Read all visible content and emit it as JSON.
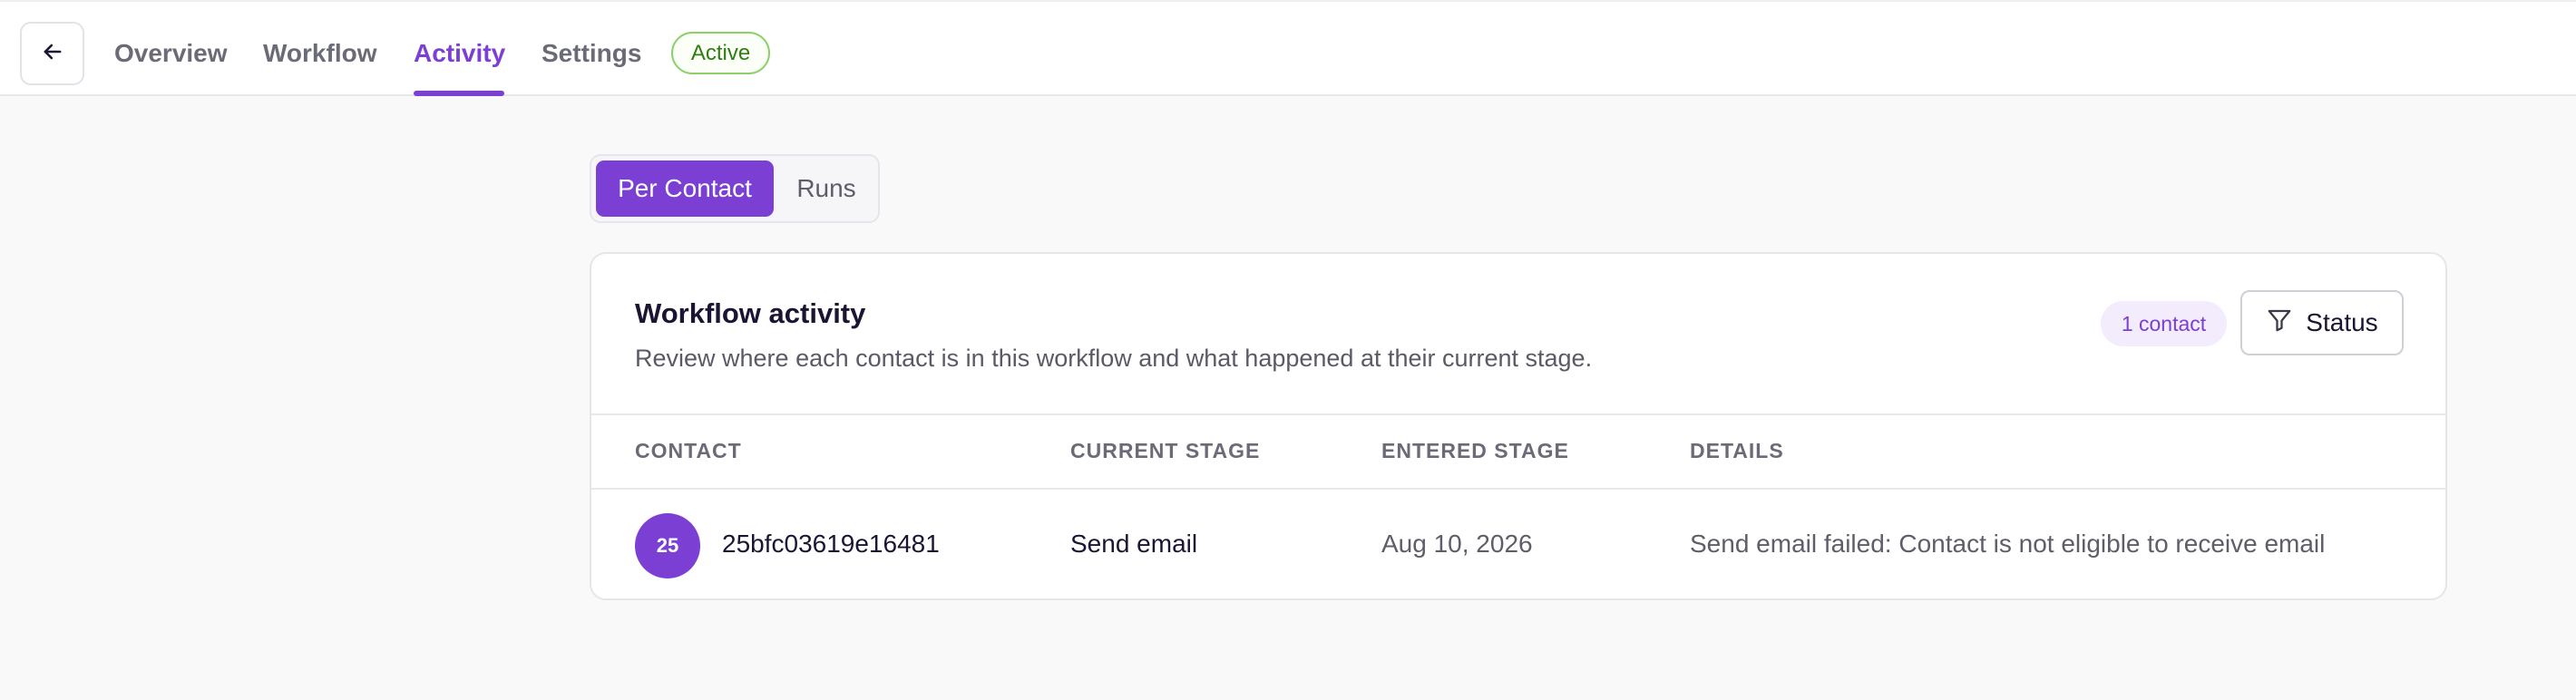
{
  "header": {
    "back_icon": "arrow-left-icon",
    "tabs": [
      {
        "label": "Overview",
        "active": false
      },
      {
        "label": "Workflow",
        "active": false
      },
      {
        "label": "Activity",
        "active": true
      },
      {
        "label": "Settings",
        "active": false
      }
    ],
    "status_badge": "Active"
  },
  "view_toggle": {
    "options": [
      "Per Contact",
      "Runs"
    ],
    "selected": "Per Contact"
  },
  "activity_card": {
    "title": "Workflow activity",
    "subtitle": "Review where each contact is in this workflow and what happened at their current stage.",
    "count_badge": "1 contact",
    "filter_label": "Status",
    "filter_icon": "filter-funnel-icon",
    "columns": [
      "CONTACT",
      "CURRENT STAGE",
      "ENTERED STAGE",
      "DETAILS"
    ],
    "rows": [
      {
        "avatar_text": "25",
        "contact": "25bfc03619e16481",
        "current_stage": "Send email",
        "entered_stage": "Aug 10, 2026",
        "details": "Send email failed: Contact is not eligible to receive email"
      }
    ]
  },
  "colors": {
    "accent": "#7b3fd4",
    "active_badge_border": "#8bd06a",
    "active_badge_text": "#2f7d12",
    "count_badge_bg": "#f3ecfd",
    "page_bg": "#f9f9f9"
  }
}
